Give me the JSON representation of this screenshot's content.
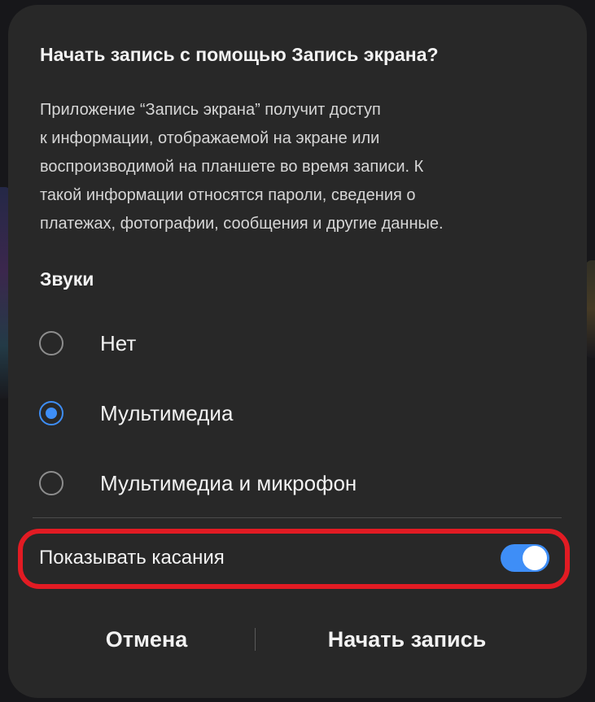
{
  "dialog": {
    "title": "Начать запись с помощью Запись экрана?",
    "body_lines": [
      "Приложение “Запись экрана” получит доступ",
      "к информации, отображаемой на экране или",
      "воспроизводимой на планшете во время записи. К",
      "такой информации относятся пароли, сведения о",
      "платежах, фотографии, сообщения и другие данные."
    ],
    "sounds": {
      "title": "Звуки",
      "options": [
        {
          "label": "Нет",
          "selected": false
        },
        {
          "label": "Мультимедиа",
          "selected": true
        },
        {
          "label": "Мультимедиа и микрофон",
          "selected": false
        }
      ]
    },
    "show_touches": {
      "label": "Показывать касания",
      "enabled": true
    },
    "buttons": {
      "cancel": "Отмена",
      "start": "Начать запись"
    }
  },
  "colors": {
    "dialog_bg": "#282828",
    "accent": "#3e8ef7",
    "highlight_border": "#e21b23"
  }
}
